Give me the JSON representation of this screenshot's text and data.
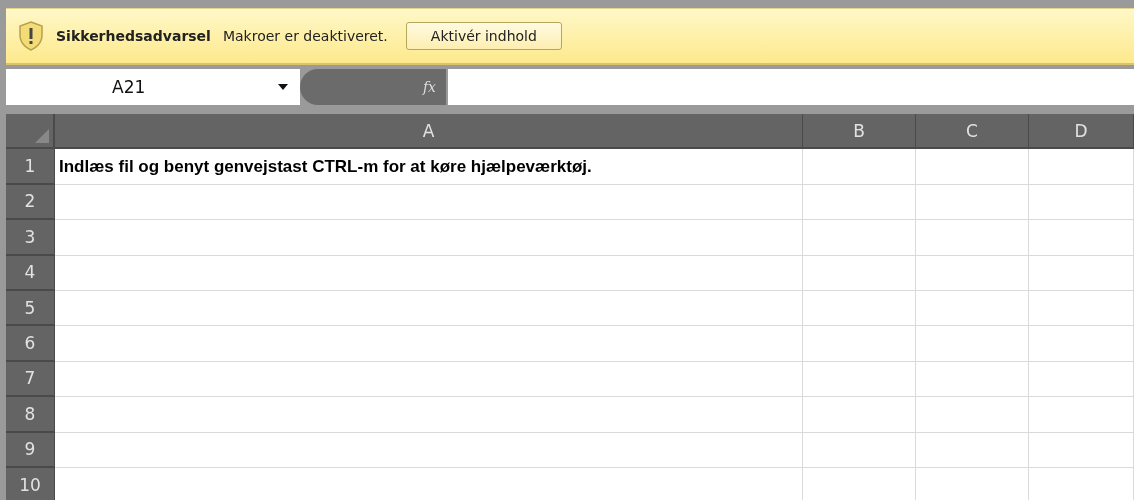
{
  "security_bar": {
    "title": "Sikkerhedsadvarsel",
    "message": "Makroer er deaktiveret.",
    "button": "Aktivér indhold"
  },
  "formula_bar": {
    "name_box": "A21",
    "function_label": "fx"
  },
  "sheet": {
    "columns": [
      "A",
      "B",
      "C",
      "D"
    ],
    "rows": [
      {
        "number": "1",
        "cells": [
          "Indlæs fil og benyt genvejstast CTRL-m for at køre hjælpeværktøj."
        ]
      },
      {
        "number": "2"
      },
      {
        "number": "3"
      },
      {
        "number": "4"
      },
      {
        "number": "5"
      },
      {
        "number": "6"
      },
      {
        "number": "7"
      },
      {
        "number": "8"
      },
      {
        "number": "9"
      },
      {
        "number": "10"
      }
    ]
  }
}
